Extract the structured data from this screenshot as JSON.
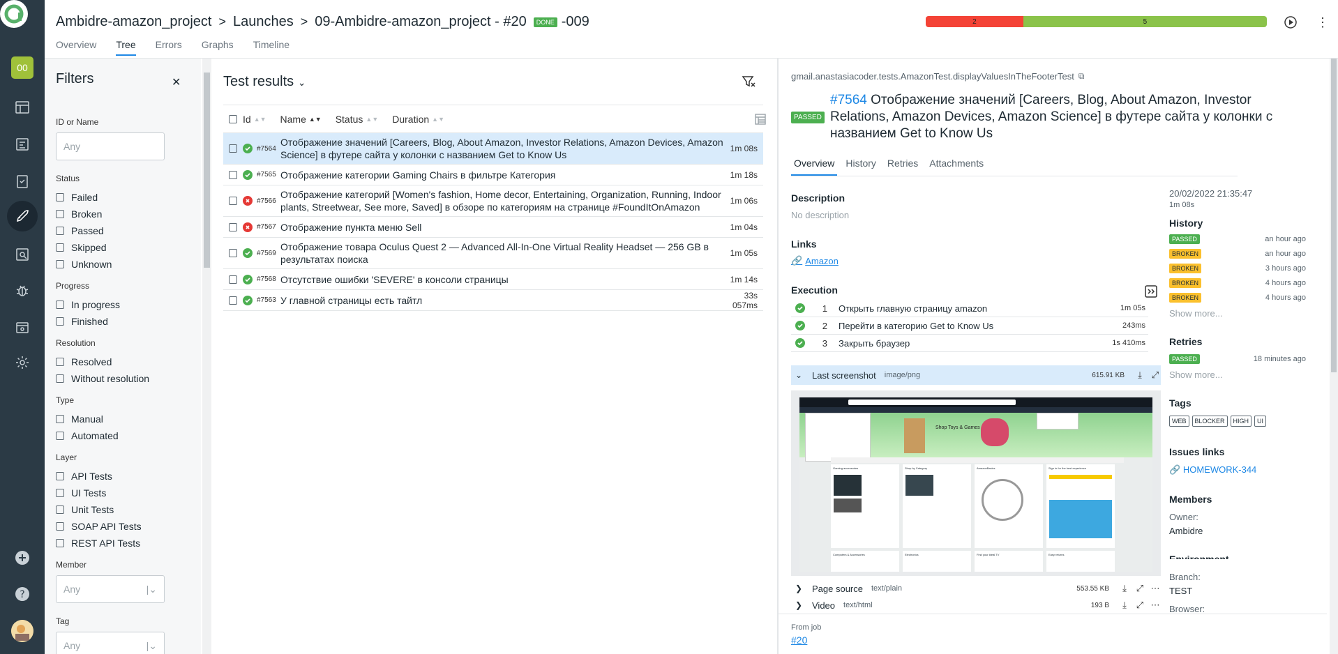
{
  "header": {
    "breadcrumb": [
      "Ambidre-amazon_project",
      "Launches",
      "09-Ambidre-amazon_project - #20"
    ],
    "status_badge": "DONE",
    "launch_suffix": "-009",
    "tabs": [
      "Overview",
      "Tree",
      "Errors",
      "Graphs",
      "Timeline"
    ],
    "active_tab": "Tree",
    "stats": {
      "failed": 2,
      "passed": 5,
      "failed_color": "#f44336",
      "passed_color": "#8bc34a"
    }
  },
  "rail": {
    "project_badge": "00",
    "icons": [
      "dashboard-icon",
      "launches-list-icon",
      "test-cases-icon",
      "test-plans-icon",
      "launches-icon",
      "analytics-icon",
      "defects-icon",
      "jobs-icon",
      "settings-icon",
      "add-icon",
      "help-icon"
    ]
  },
  "filters": {
    "title": "Filters",
    "id_or_name": {
      "label": "ID or Name",
      "placeholder": "Any"
    },
    "groups": [
      {
        "label": "Status",
        "options": [
          "Failed",
          "Broken",
          "Passed",
          "Skipped",
          "Unknown"
        ]
      },
      {
        "label": "Progress",
        "options": [
          "In progress",
          "Finished"
        ]
      },
      {
        "label": "Resolution",
        "options": [
          "Resolved",
          "Without resolution"
        ]
      },
      {
        "label": "Type",
        "options": [
          "Manual",
          "Automated"
        ]
      },
      {
        "label": "Layer",
        "options": [
          "API Tests",
          "UI Tests",
          "Unit Tests",
          "SOAP API Tests",
          "REST API Tests"
        ]
      }
    ],
    "member": {
      "label": "Member",
      "placeholder": "Any"
    },
    "tag": {
      "label": "Tag",
      "placeholder": "Any"
    }
  },
  "results": {
    "title": "Test results",
    "columns": [
      "Id",
      "Name",
      "Status",
      "Duration"
    ],
    "rows": [
      {
        "status": "passed",
        "id": "#7564",
        "name": "Отображение значений [Careers, Blog, About Amazon, Investor Relations, Amazon Devices, Amazon Science] в футере сайта у колонки с названием Get to Know Us",
        "duration": "1m 08s",
        "selected": true
      },
      {
        "status": "passed",
        "id": "#7565",
        "name": "Отображение категории Gaming Chairs в фильтре Категория",
        "duration": "1m 18s"
      },
      {
        "status": "broken",
        "id": "#7566",
        "name": "Отображение категорий [Women's fashion, Home decor, Entertaining, Organization, Running, Indoor plants, Streetwear, See more, Saved] в обзоре по категориям на странице #FoundItOnAmazon",
        "duration": "1m 06s"
      },
      {
        "status": "broken",
        "id": "#7567",
        "name": "Отображение пункта меню Sell",
        "duration": "1m 04s"
      },
      {
        "status": "passed",
        "id": "#7569",
        "name": "Отображение товара Oculus Quest 2 — Advanced All-In-One Virtual Reality Headset — 256 GB в результатах поиска",
        "duration": "1m 05s"
      },
      {
        "status": "passed",
        "id": "#7568",
        "name": "Отсутствие ошибки 'SEVERE' в консоли страницы",
        "duration": "1m 14s"
      },
      {
        "status": "passed",
        "id": "#7563",
        "name": "У главной страницы есть тайтл",
        "duration": "33s 057ms"
      }
    ]
  },
  "details": {
    "full_name": "gmail.anastasiacoder.tests.AmazonTest.displayValuesInTheFooterTest",
    "status": "PASSED",
    "number": "#7564",
    "title": "Отображение значений [Careers, Blog, About Amazon, Investor Relations, Amazon Devices, Amazon Science] в футере сайта у колонки с названием Get to Know Us",
    "tabs": [
      "Overview",
      "History",
      "Retries",
      "Attachments"
    ],
    "active_tab": "Overview",
    "description_label": "Description",
    "description": "No description",
    "links_label": "Links",
    "link": "Amazon",
    "execution_label": "Execution",
    "steps": [
      {
        "num": "1",
        "name": "Открыть главную страницу amazon",
        "duration": "1m 05s"
      },
      {
        "num": "2",
        "name": "Перейти в категорию Get to Know Us",
        "duration": "243ms"
      },
      {
        "num": "3",
        "name": "Закрыть браузер",
        "duration": "1s 410ms"
      }
    ],
    "attachments": [
      {
        "name": "Last screenshot",
        "type": "image/png",
        "size": "615.91 KB"
      },
      {
        "name": "Page source",
        "type": "text/plain",
        "size": "553.55 KB"
      },
      {
        "name": "Video",
        "type": "text/html",
        "size": "193 B"
      }
    ],
    "from_job_label": "From job",
    "from_job": "#20"
  },
  "side": {
    "date": "20/02/2022 21:35:47",
    "duration": "1m 08s",
    "history_label": "History",
    "history": [
      {
        "status": "PASSED",
        "time": "an hour ago"
      },
      {
        "status": "BROKEN",
        "time": "an hour ago"
      },
      {
        "status": "BROKEN",
        "time": "3 hours ago"
      },
      {
        "status": "BROKEN",
        "time": "4 hours ago"
      },
      {
        "status": "BROKEN",
        "time": "4 hours ago"
      }
    ],
    "show_more": "Show more...",
    "retries_label": "Retries",
    "retries": [
      {
        "status": "PASSED",
        "time": "18 minutes ago"
      }
    ],
    "tags_label": "Tags",
    "tags": [
      "WEB",
      "BLOCKER",
      "HIGH",
      "UI"
    ],
    "issues_label": "Issues links",
    "issue": "HOMEWORK-344",
    "members_label": "Members",
    "owner_label": "Owner:",
    "owner": "Ambidre",
    "environment_label": "Environment",
    "branch_label": "Branch:",
    "branch": "TEST",
    "browser_label": "Browser:"
  },
  "screenshot": {
    "shop_banner": "Shop Toys & Games",
    "cards": [
      "Gaming accessories",
      "Shop by Category",
      "AmazonBasics",
      "Sign in for the best experience"
    ],
    "cards2": [
      "Computers & Accessories",
      "Electronics",
      "Find your ideal TV",
      "Easy returns"
    ]
  }
}
